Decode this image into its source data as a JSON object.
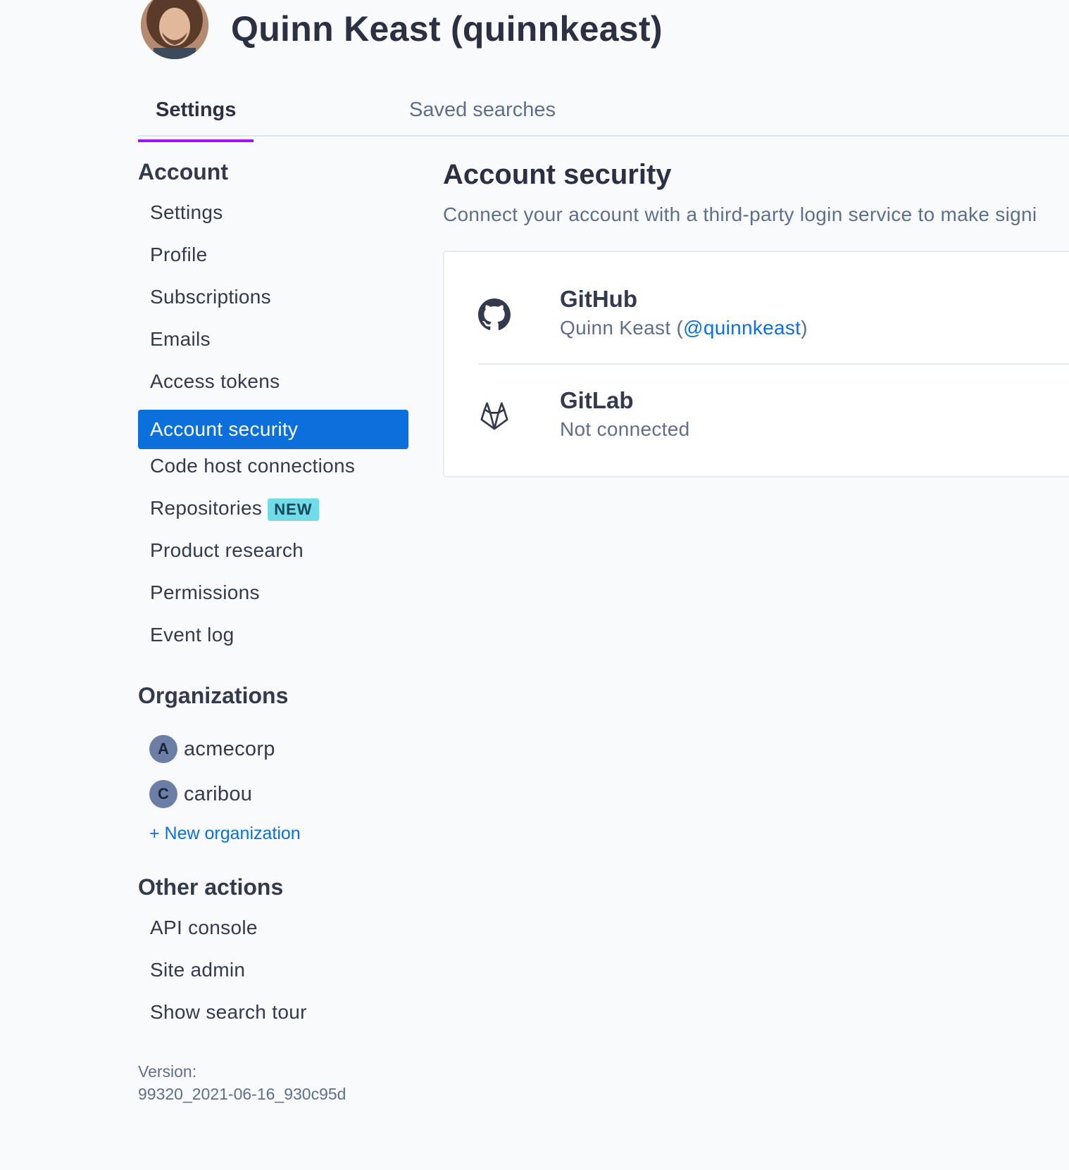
{
  "header": {
    "title": "Quinn Keast (quinnkeast)",
    "avatar_alt": "Quinn Keast avatar"
  },
  "tabs": [
    {
      "label": "Settings",
      "active": true
    },
    {
      "label": "Saved searches",
      "active": false
    }
  ],
  "sidebar": {
    "account_title": "Account",
    "account_items": [
      {
        "label": "Settings"
      },
      {
        "label": "Profile"
      },
      {
        "label": "Subscriptions"
      },
      {
        "label": "Emails"
      },
      {
        "label": "Access tokens"
      },
      {
        "label": "Account security",
        "active": true
      },
      {
        "label": "Code host connections"
      },
      {
        "label": "Repositories",
        "badge": "NEW"
      },
      {
        "label": "Product research"
      },
      {
        "label": "Permissions"
      },
      {
        "label": "Event log"
      }
    ],
    "organizations_title": "Organizations",
    "organizations": [
      {
        "initial": "A",
        "name": "acmecorp"
      },
      {
        "initial": "C",
        "name": "caribou"
      }
    ],
    "new_org_label": "+ New organization",
    "other_title": "Other actions",
    "other_items": [
      {
        "label": "API console"
      },
      {
        "label": "Site admin"
      },
      {
        "label": "Show search tour"
      }
    ],
    "version_label": "Version:",
    "version_value": "99320_2021-06-16_930c95d"
  },
  "main": {
    "title": "Account security",
    "description": "Connect your account with a third-party login service to make signi",
    "providers": [
      {
        "icon": "github-icon",
        "name": "GitHub",
        "status_prefix": "Quinn Keast (",
        "handle": "@quinnkeast",
        "status_suffix": ")"
      },
      {
        "icon": "gitlab-icon",
        "name": "GitLab",
        "status": "Not connected"
      }
    ]
  },
  "colors": {
    "accent": "#0b70db",
    "tab_underline": "#a112ff",
    "badge_bg": "#72dbe8",
    "background": "#f9fafb"
  }
}
